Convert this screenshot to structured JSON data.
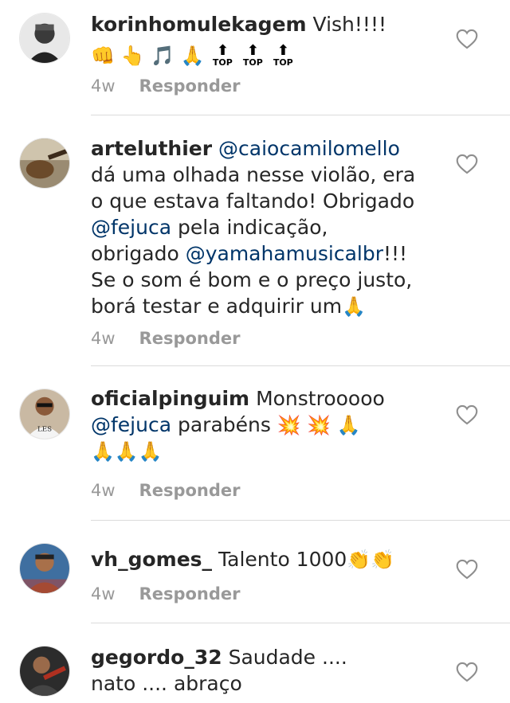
{
  "comments": [
    {
      "username": "korinhomulekagem",
      "text": "Vish!!!!",
      "emoji_line": "👊 👆 🎵 🙏",
      "top_label": "TOP",
      "time": "4w",
      "reply_label": "Responder"
    },
    {
      "username": "arteluthier",
      "mention1": "@caiocamilomello",
      "line2": "dá uma olhada nesse violão, era",
      "line3": "o que estava faltando! Obrigado",
      "mention2": "@fejuca",
      "line4_rest": " pela indicação,",
      "line5_pre": "obrigado ",
      "mention3": "@yamahamusicalbr",
      "line5_post": "!!!",
      "line6": "Se o som é bom e o preço justo,",
      "line7": "borá testar e adquirir um",
      "line7_emoji": "🙏",
      "time": "4w",
      "reply_label": "Responder"
    },
    {
      "username": "oficialpinguim",
      "text": "Monstrooooo",
      "mention": "@fejuca",
      "text2": " parabéns",
      "emoji_line1": " 💥 💥 🙏",
      "emoji_line2": "🙏🙏🙏",
      "avatar_text": "LES",
      "time": "4w",
      "reply_label": "Responder"
    },
    {
      "username": "vh_gomes_",
      "text": "Talento 1000",
      "emoji": "👏👏",
      "time": "4w",
      "reply_label": "Responder"
    },
    {
      "username": "gegordo_32",
      "text": "Saudade ....",
      "line2": "nato .... abraço"
    }
  ]
}
